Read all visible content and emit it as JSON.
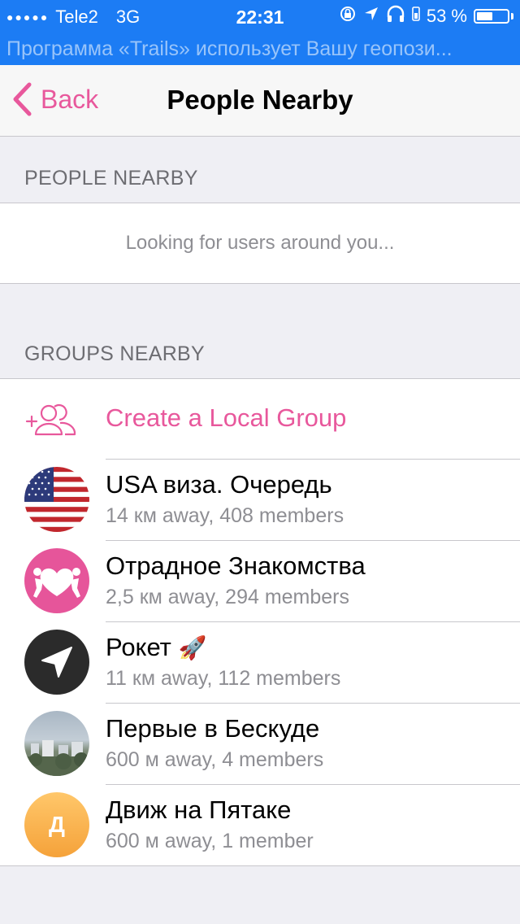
{
  "status_bar": {
    "signal_dots": "●●●●●",
    "carrier": "Tele2",
    "network": "3G",
    "time": "22:31",
    "battery_percent": "53 %",
    "battery_level": 0.53
  },
  "banner": {
    "text": "Программа «Trails» использует Вашу геопози..."
  },
  "navbar": {
    "back_label": "Back",
    "title": "People Nearby"
  },
  "people_section": {
    "header": "PEOPLE NEARBY",
    "status_text": "Looking for users around you..."
  },
  "groups_section": {
    "header": "GROUPS NEARBY",
    "create_label": "Create a Local Group",
    "groups": [
      {
        "name": "USA виза. Очередь",
        "subtitle": "14 км away, 408 members"
      },
      {
        "name": "Отрадное Знакомства",
        "subtitle": "2,5 км away, 294 members"
      },
      {
        "name": "Рокет",
        "emoji": "🚀",
        "subtitle": "11 км away, 112 members"
      },
      {
        "name": "Первые в Бескуде",
        "subtitle": "600 м away, 4 members"
      },
      {
        "name": "Движ на Пятаке",
        "subtitle": "600 м away, 1 member",
        "avatar_letter": "Д"
      }
    ]
  },
  "colors": {
    "accent": "#e8589c",
    "status_bar": "#1c7cf4",
    "background": "#efeff4"
  }
}
